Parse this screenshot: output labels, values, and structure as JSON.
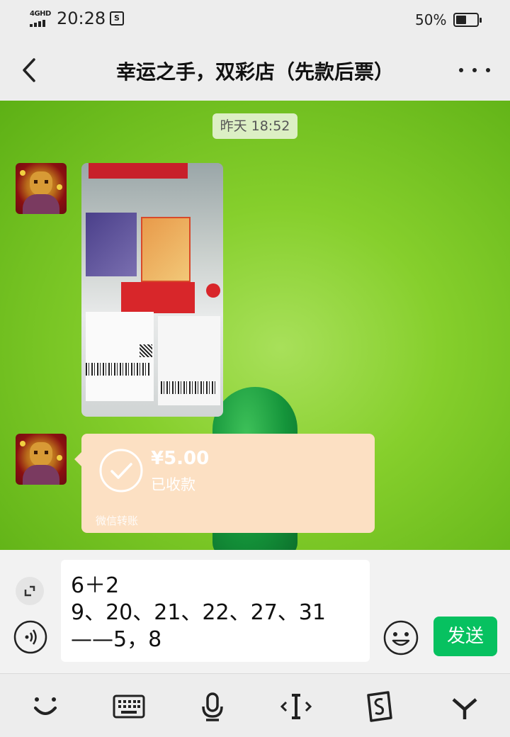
{
  "status_bar": {
    "network": "4GHD",
    "time": "20:28",
    "extra_icon": "S",
    "battery_percent": "50%",
    "battery_level": 0.5
  },
  "header": {
    "title": "幸运之手，双彩店（先款后票）",
    "back_icon": "chevron-left-icon",
    "more_icon": "more-dots-icon"
  },
  "chat": {
    "timestamp": "昨天 18:52",
    "messages": [
      {
        "type": "image",
        "sender_avatar": "avatar-icon",
        "content": "photo of lottery tickets"
      },
      {
        "type": "transfer",
        "amount": "¥5.00",
        "status": "已收款",
        "label": "微信转账"
      }
    ]
  },
  "composer": {
    "lines": [
      "6＋2",
      "9、20、21、22、27、31",
      "——5，8"
    ],
    "send_label": "发送"
  },
  "toolbar": {
    "icons": [
      "smile-icon",
      "keyboard-icon",
      "microphone-icon",
      "text-cursor-icon",
      "clipboard-icon",
      "collapse-icon"
    ]
  }
}
